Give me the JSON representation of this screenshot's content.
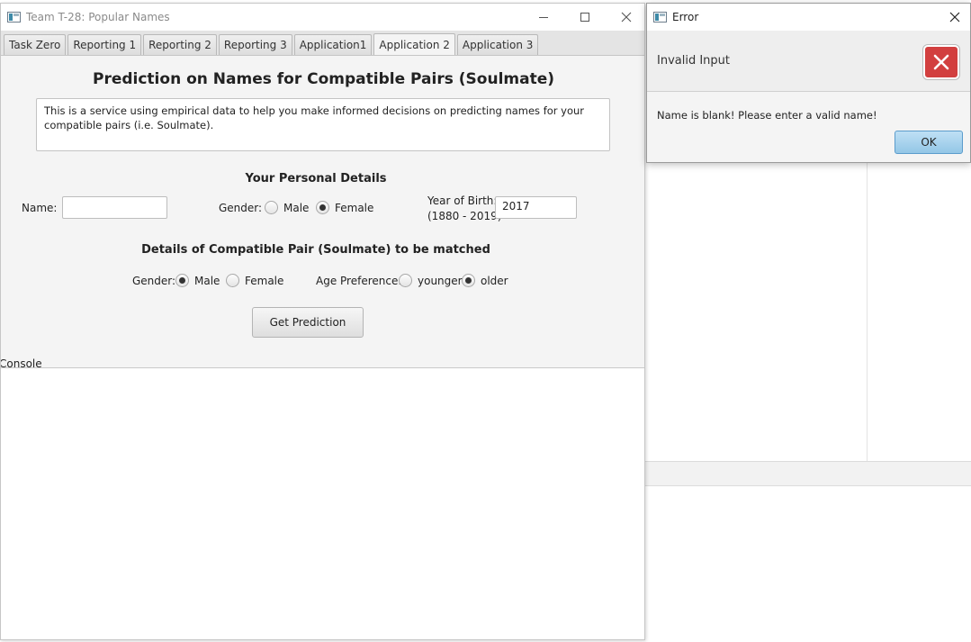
{
  "window": {
    "title": "Team T-28: Popular Names"
  },
  "tabs": [
    {
      "label": "Task Zero"
    },
    {
      "label": "Reporting 1"
    },
    {
      "label": "Reporting 2"
    },
    {
      "label": "Reporting 3"
    },
    {
      "label": "Application1"
    },
    {
      "label": "Application 2"
    },
    {
      "label": "Application 3"
    }
  ],
  "active_tab": "Application 2",
  "main": {
    "title": "Prediction on Names for Compatible Pairs (Soulmate)",
    "description": "This is a service using empirical data to help you make informed decisions on predicting names for your compatible pairs (i.e. Soulmate).",
    "personal": {
      "section_title": "Your Personal Details",
      "name_label": "Name:",
      "name_value": "",
      "gender_label": "Gender:",
      "male_label": "Male",
      "female_label": "Female",
      "gender_selected": "Female",
      "yob_label_line1": "Year of Birth:",
      "yob_label_line2": "(1880 - 2019)",
      "yob_value": "2017"
    },
    "pair": {
      "section_title": "Details of Compatible Pair (Soulmate) to be matched",
      "gender_label": "Gender:",
      "male_label": "Male",
      "female_label": "Female",
      "gender_selected": "Male",
      "age_pref_label": "Age Preference:",
      "younger_label": "younger",
      "older_label": "older",
      "age_selected": "older"
    },
    "predict_button": "Get Prediction",
    "console_label": "Console"
  },
  "dialog": {
    "title": "Error",
    "header": "Invalid Input",
    "message": "Name is blank! Please enter a valid name!",
    "ok_label": "OK",
    "icon": "error-x-icon"
  },
  "colors": {
    "error_red": "#d23f3f",
    "ok_blue": "#93c6e6"
  }
}
